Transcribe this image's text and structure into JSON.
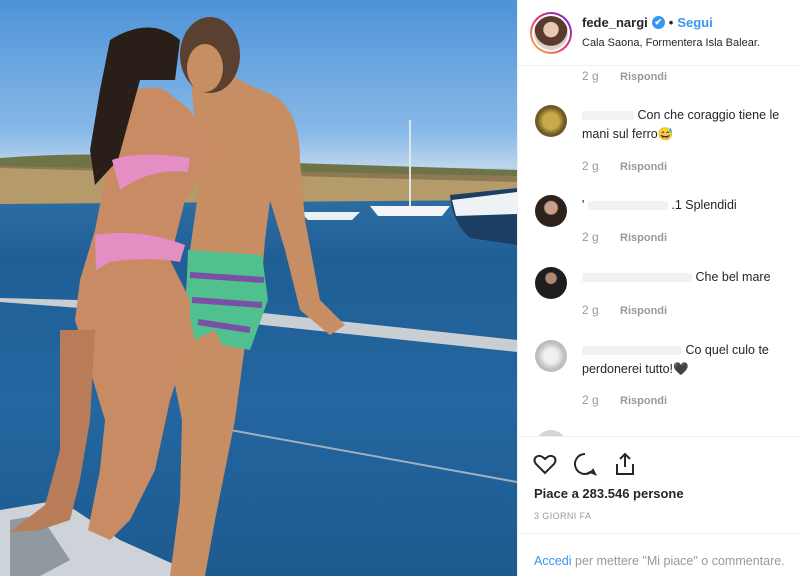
{
  "post": {
    "username": "fede_nargi",
    "verified_symbol": "✔",
    "separator": "•",
    "follow_label": "Segui",
    "location": "Cala Saona, Formentera Isla Balear."
  },
  "comments": [
    {
      "time": "2 g",
      "reply": "Rispondi"
    },
    {
      "text": "Con che coraggio tiene le mani sul ferro😅",
      "time": "2 g",
      "reply": "Rispondi",
      "avatar_color": "#8a7a3a"
    },
    {
      "text_prefix": "'",
      "text": ".1 Splendidi",
      "time": "2 g",
      "reply": "Rispondi",
      "avatar_color": "#3b2f2a"
    },
    {
      "text": "Che bel mare",
      "time": "2 g",
      "reply": "Rispondi",
      "avatar_color": "#2a2a2a"
    },
    {
      "text": "Co quel culo te perdonerei tutto!🖤",
      "time": "2 g",
      "reply": "Rispondi",
      "avatar_color": "#bdbdbd"
    }
  ],
  "actions": {
    "likes": "Piace a 283.546 persone",
    "timestamp": "3 GIORNI FA",
    "login_link": "Accedi",
    "login_rest": " per mettere \"Mi piace\" o commentare."
  },
  "colors": {
    "accent": "#3897f0",
    "muted": "#999999"
  },
  "icons": [
    "heart-icon",
    "comment-icon",
    "share-icon",
    "verified-badge-icon"
  ]
}
